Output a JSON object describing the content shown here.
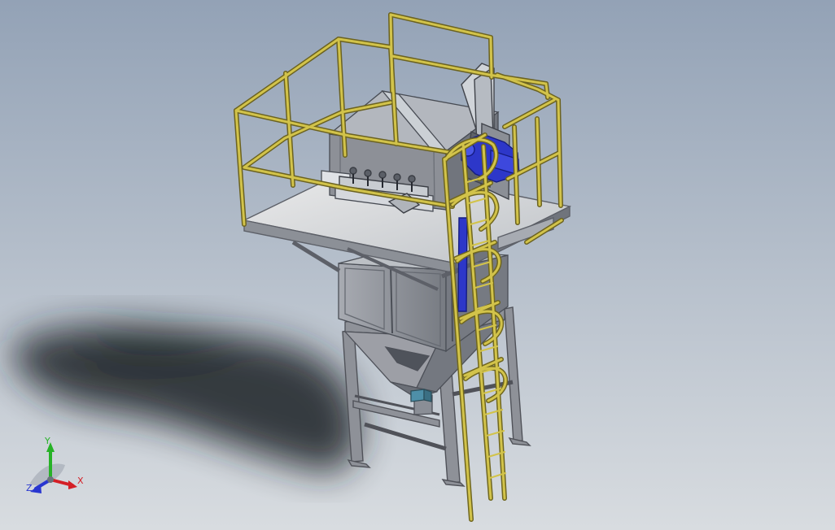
{
  "background": {
    "top": "#93a2b6",
    "bottom": "#d8dce0",
    "shadow": "#1e2124"
  },
  "colors": {
    "railing": "#d2c34a",
    "railing_dark": "#807320",
    "panel_light": "#d4d7dc",
    "panel_mid": "#a8abb3",
    "panel_dark": "#7a7d85",
    "steel": "#8e9198",
    "steel_dark": "#60636a",
    "motor": "#2d37c9",
    "motor_dark": "#151c80",
    "fitting": "#4e8fa8",
    "axis_x": "#d41f26",
    "axis_y": "#27b227",
    "axis_z": "#2836d0"
  },
  "triad": {
    "icon": "view-orientation-triad-icon",
    "x_label": "X",
    "y_label": "Y",
    "z_label": "Z"
  }
}
